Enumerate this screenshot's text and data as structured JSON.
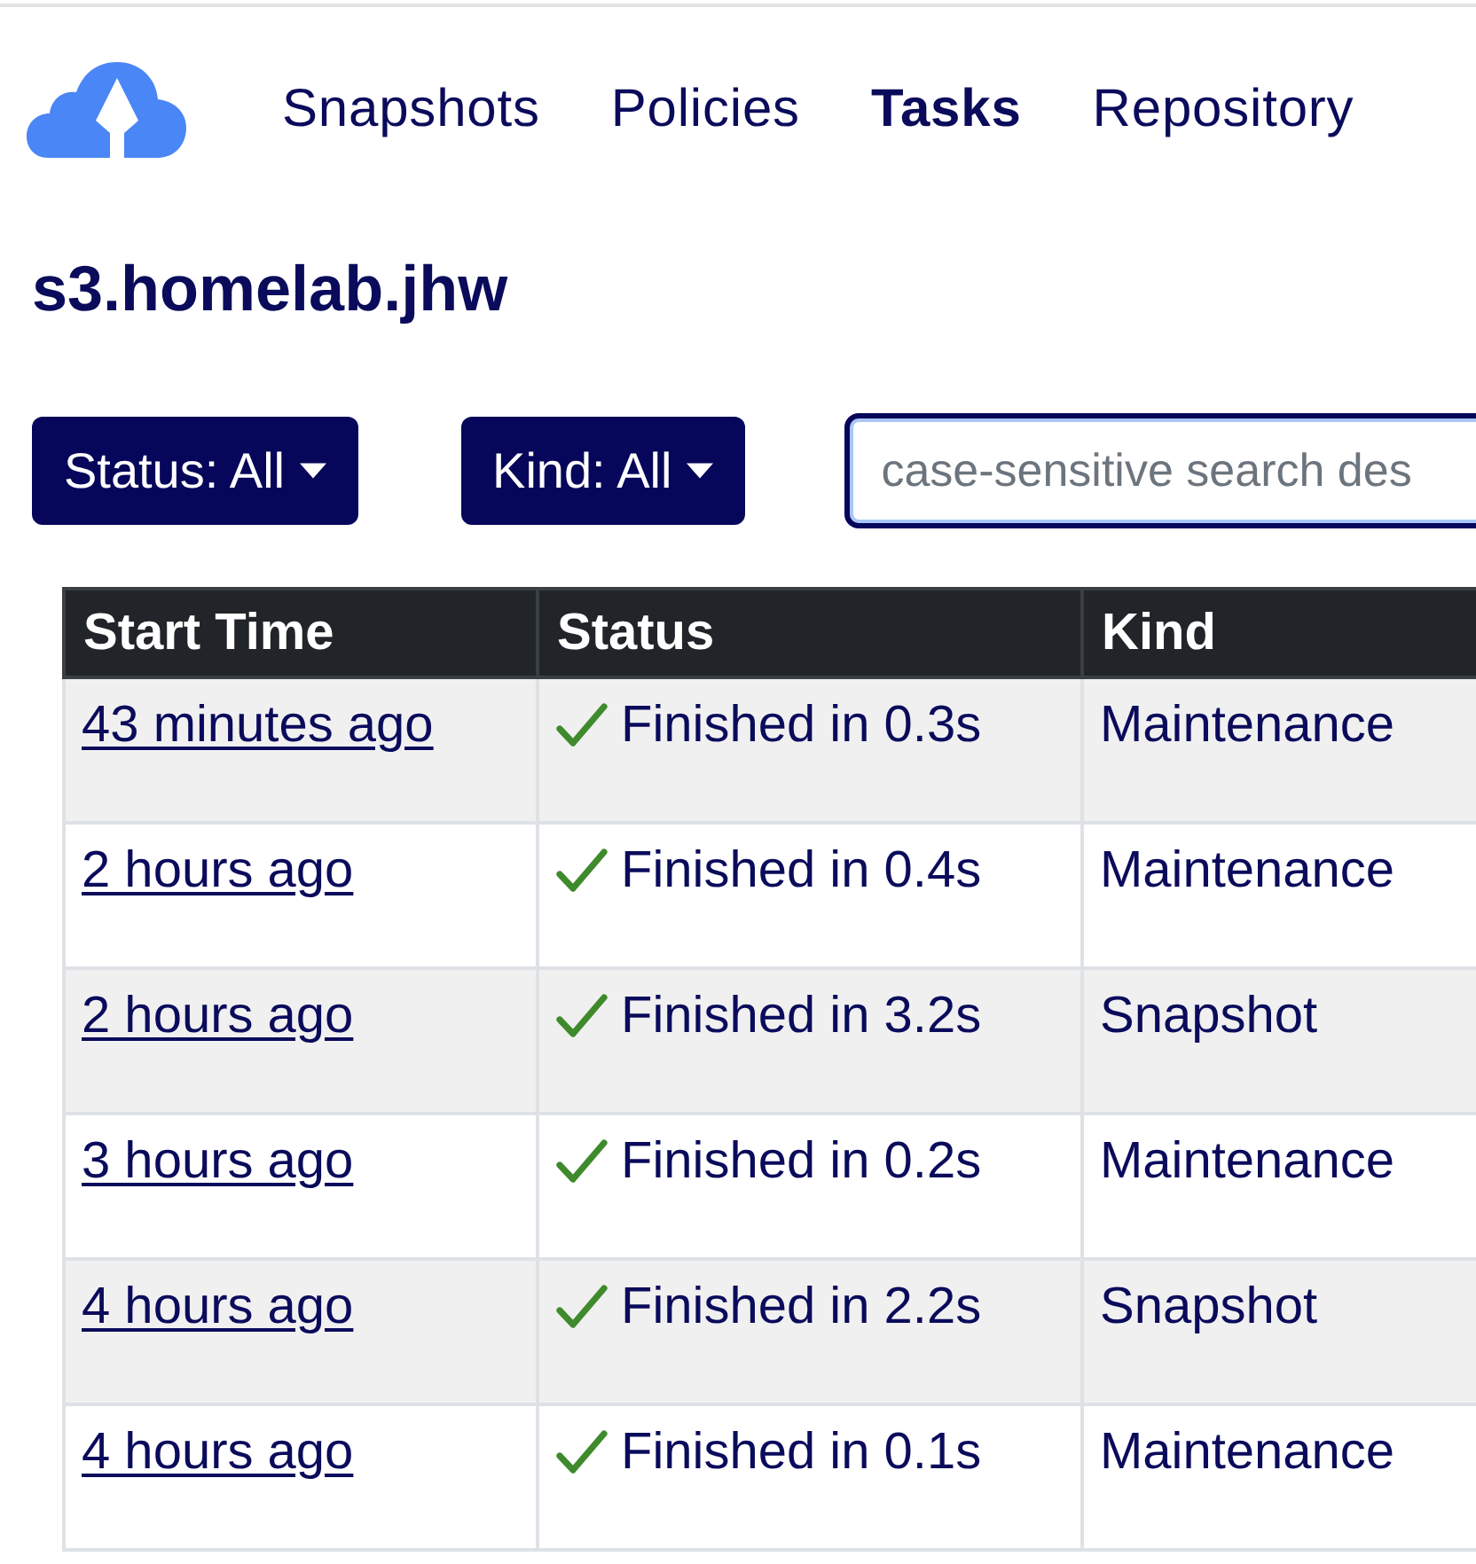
{
  "nav": {
    "items": [
      {
        "label": "Snapshots",
        "selected": false
      },
      {
        "label": "Policies",
        "selected": false
      },
      {
        "label": "Tasks",
        "selected": true
      },
      {
        "label": "Repository",
        "selected": false
      }
    ]
  },
  "repository_title": "s3.homelab.jhw",
  "filters": [
    {
      "label": "Status: All"
    },
    {
      "label": "Kind: All"
    }
  ],
  "search": {
    "placeholder": "case-sensitive search des"
  },
  "table": {
    "columns": [
      "Start Time",
      "Status",
      "Kind"
    ],
    "rows": [
      {
        "start_time": "43 minutes ago",
        "status": "Finished in 0.3s",
        "kind": "Maintenance"
      },
      {
        "start_time": "2 hours ago",
        "status": "Finished in 0.4s",
        "kind": "Maintenance"
      },
      {
        "start_time": "2 hours ago",
        "status": "Finished in 3.2s",
        "kind": "Snapshot"
      },
      {
        "start_time": "3 hours ago",
        "status": "Finished in 0.2s",
        "kind": "Maintenance"
      },
      {
        "start_time": "4 hours ago",
        "status": "Finished in 2.2s",
        "kind": "Snapshot"
      },
      {
        "start_time": "4 hours ago",
        "status": "Finished in 0.1s",
        "kind": "Maintenance"
      }
    ]
  }
}
